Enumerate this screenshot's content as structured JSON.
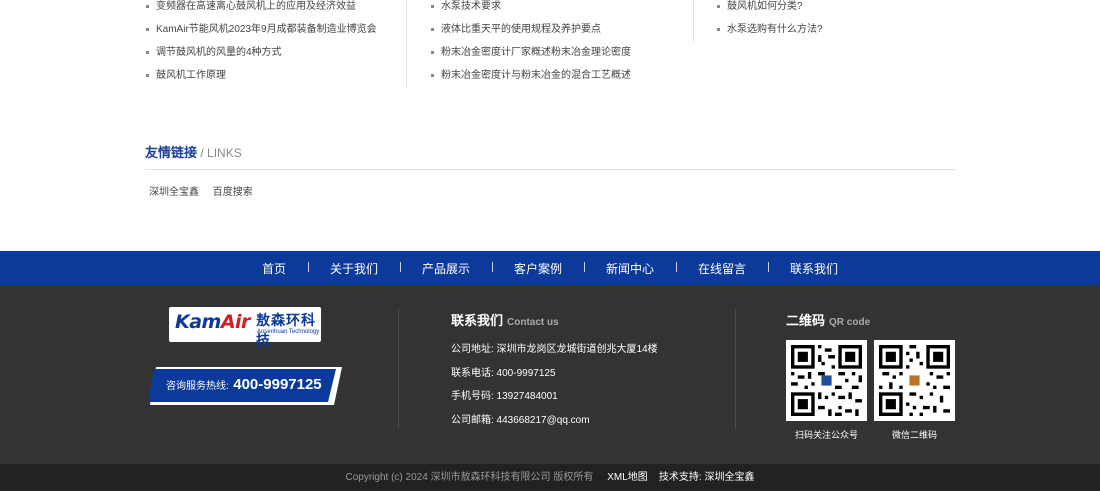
{
  "news": {
    "col1": [
      "变频器在高速离心鼓风机上的应用及经济效益",
      "KamAir节能风机2023年9月成都装备制造业博览会",
      "调节鼓风机的风量的4种方式",
      "鼓风机工作原理"
    ],
    "col2": [
      "水泵技术要求",
      "液体比重天平的使用规程及养护要点",
      "粉末冶金密度计厂家概述粉末冶金理论密度",
      "粉末冶金密度计与粉末冶金的混合工艺概述"
    ],
    "col3": [
      "鼓风机如何分类?",
      "水泵选购有什么方法?"
    ]
  },
  "links": {
    "title_cn": "友情链接",
    "title_en": " / LINKS",
    "items": [
      "深圳全宝鑫",
      "百度搜索"
    ]
  },
  "nav": [
    "首页",
    "关于我们",
    "产品展示",
    "客户案例",
    "新闻中心",
    "在线留言",
    "联系我们"
  ],
  "footer": {
    "logo_mark_a": "Kam",
    "logo_mark_b": "Air",
    "logo_cn": "敖森环科技",
    "logo_en": "Aosenhuan Technology",
    "hotline_label": "咨询服务热线:",
    "hotline_number": "400-9997125",
    "contact_title_cn": "联系我们",
    "contact_title_en": "Contact us",
    "contact_rows": [
      "公司地址: 深圳市龙岗区龙城街道创兆大厦14楼",
      "联系电话: 400-9997125",
      "手机号码: 13927484001",
      "公司邮箱: 443668217@qq.com"
    ],
    "qr_title_cn": "二维码",
    "qr_title_en": "QR code",
    "qr_captions": [
      "扫码关注公众号",
      "微信二维码"
    ]
  },
  "bottom": {
    "copyright": "Copyright (c) 2024 深圳市敖森环科技有限公司 版权所有",
    "xml": "XML地图",
    "support": "技术支持: 深圳全宝鑫"
  },
  "colors": {
    "brand_blue": "#0b3a9b",
    "footer_bg": "#333333",
    "bottom_bg": "#222222"
  }
}
